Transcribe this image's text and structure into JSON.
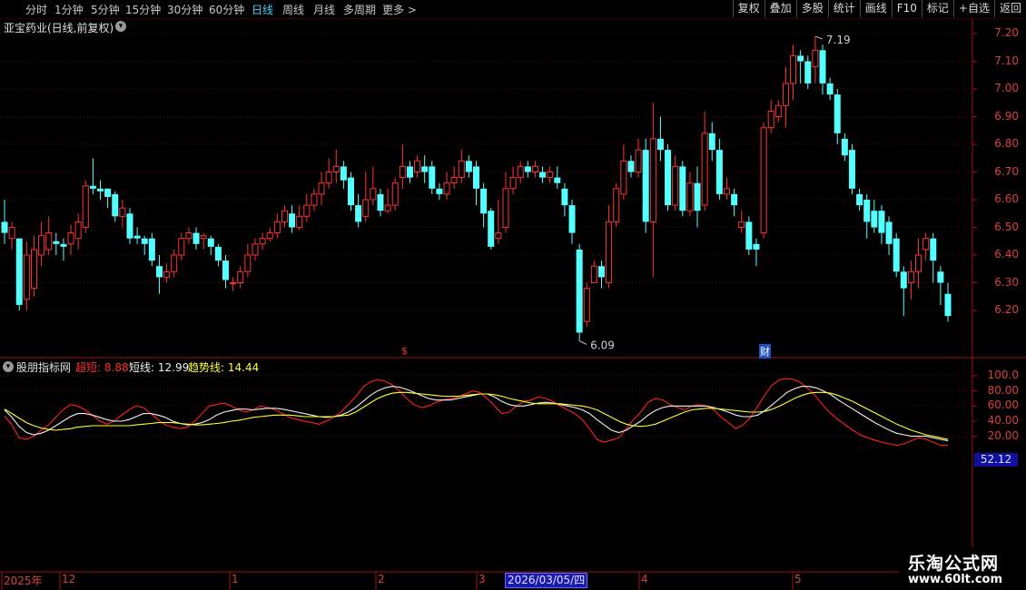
{
  "toolbar": {
    "timeframes": [
      {
        "label": "分时",
        "active": false
      },
      {
        "label": "1分钟",
        "active": false
      },
      {
        "label": "5分钟",
        "active": false
      },
      {
        "label": "15分钟",
        "active": false
      },
      {
        "label": "30分钟",
        "active": false
      },
      {
        "label": "60分钟",
        "active": false
      },
      {
        "label": "日线",
        "active": true
      },
      {
        "label": "周线",
        "active": false
      },
      {
        "label": "月线",
        "active": false
      },
      {
        "label": "多周期",
        "active": false
      },
      {
        "label": "更多 >",
        "active": false
      }
    ],
    "right_buttons": [
      "复权",
      "叠加",
      "多股",
      "统计",
      "画线",
      "F10",
      "标记",
      "+自选",
      "返回"
    ]
  },
  "stock": {
    "title": "亚宝药业(日线,前复权)",
    "dropdown_icon": "chevron-down-icon",
    "high_label": "7.19",
    "low_label": "6.09",
    "event_markers": [
      "$",
      "财"
    ]
  },
  "price_axis": [
    "7.20",
    "7.10",
    "7.00",
    "6.90",
    "6.80",
    "6.70",
    "6.60",
    "6.50",
    "6.40",
    "6.30",
    "6.20"
  ],
  "indicator": {
    "title": "股朋指标网",
    "lines": [
      {
        "name": "超短",
        "value": "8.88",
        "color": "#ff2020"
      },
      {
        "name": "短线",
        "value": "12.99",
        "color": "#f0f0f0"
      },
      {
        "name": "趋势线",
        "value": "14.44",
        "color": "#ffff30"
      }
    ],
    "axis": [
      "100.0",
      "80.00",
      "60.00",
      "40.00",
      "20.00"
    ],
    "cursor_value": "52.12"
  },
  "date_axis": {
    "labels": [
      "2025年",
      "12",
      "1",
      "2",
      "3",
      "4",
      "5"
    ],
    "cursor_date": "2026/03/05/四"
  },
  "watermark": {
    "title": "乐淘公式网",
    "url": "www.60lt.com"
  },
  "colors": {
    "up": "#ff3232",
    "down": "#54ffff",
    "grid": "#5a0000",
    "bg": "#000000"
  },
  "chart_data": {
    "type": "candlestick",
    "ylim": [
      6.09,
      7.19
    ],
    "candles": [
      [
        6.52,
        6.48,
        6.6,
        6.44
      ],
      [
        6.46,
        6.5,
        6.52,
        6.42
      ],
      [
        6.46,
        6.22,
        6.46,
        6.2
      ],
      [
        6.24,
        6.4,
        6.45,
        6.2
      ],
      [
        6.28,
        6.42,
        6.47,
        6.25
      ],
      [
        6.4,
        6.47,
        6.52,
        6.36
      ],
      [
        6.42,
        6.48,
        6.54,
        6.4
      ],
      [
        6.45,
        6.44,
        6.48,
        6.4
      ],
      [
        6.44,
        6.43,
        6.46,
        6.38
      ],
      [
        6.44,
        6.48,
        6.51,
        6.4
      ],
      [
        6.46,
        6.52,
        6.55,
        6.42
      ],
      [
        6.5,
        6.65,
        6.67,
        6.48
      ],
      [
        6.65,
        6.64,
        6.75,
        6.62
      ],
      [
        6.64,
        6.63,
        6.67,
        6.6
      ],
      [
        6.64,
        6.61,
        6.64,
        6.57
      ],
      [
        6.62,
        6.54,
        6.63,
        6.52
      ],
      [
        6.54,
        6.57,
        6.6,
        6.5
      ],
      [
        6.55,
        6.46,
        6.57,
        6.44
      ],
      [
        6.47,
        6.46,
        6.5,
        6.44
      ],
      [
        6.46,
        6.44,
        6.47,
        6.4
      ],
      [
        6.46,
        6.38,
        6.48,
        6.36
      ],
      [
        6.36,
        6.32,
        6.4,
        6.26
      ],
      [
        6.32,
        6.34,
        6.37,
        6.3
      ],
      [
        6.34,
        6.4,
        6.42,
        6.32
      ],
      [
        6.4,
        6.46,
        6.48,
        6.38
      ],
      [
        6.46,
        6.48,
        6.5,
        6.44
      ],
      [
        6.48,
        6.44,
        6.5,
        6.42
      ],
      [
        6.46,
        6.47,
        6.48,
        6.42
      ],
      [
        6.46,
        6.43,
        6.47,
        6.4
      ],
      [
        6.43,
        6.38,
        6.44,
        6.36
      ],
      [
        6.38,
        6.31,
        6.4,
        6.28
      ],
      [
        6.3,
        6.3,
        6.32,
        6.27
      ],
      [
        6.3,
        6.34,
        6.36,
        6.28
      ],
      [
        6.34,
        6.4,
        6.44,
        6.32
      ],
      [
        6.4,
        6.44,
        6.46,
        6.38
      ],
      [
        6.44,
        6.46,
        6.48,
        6.42
      ],
      [
        6.46,
        6.48,
        6.5,
        6.45
      ],
      [
        6.48,
        6.52,
        6.55,
        6.46
      ],
      [
        6.52,
        6.56,
        6.58,
        6.5
      ],
      [
        6.55,
        6.5,
        6.58,
        6.48
      ],
      [
        6.5,
        6.54,
        6.58,
        6.49
      ],
      [
        6.54,
        6.58,
        6.62,
        6.52
      ],
      [
        6.58,
        6.62,
        6.64,
        6.56
      ],
      [
        6.62,
        6.66,
        6.7,
        6.58
      ],
      [
        6.66,
        6.7,
        6.75,
        6.64
      ],
      [
        6.7,
        6.72,
        6.78,
        6.66
      ],
      [
        6.72,
        6.67,
        6.74,
        6.64
      ],
      [
        6.68,
        6.58,
        6.7,
        6.56
      ],
      [
        6.58,
        6.52,
        6.62,
        6.5
      ],
      [
        6.54,
        6.6,
        6.7,
        6.52
      ],
      [
        6.6,
        6.64,
        6.72,
        6.58
      ],
      [
        6.62,
        6.56,
        6.64,
        6.54
      ],
      [
        6.56,
        6.58,
        6.64,
        6.55
      ],
      [
        6.58,
        6.66,
        6.68,
        6.56
      ],
      [
        6.68,
        6.72,
        6.8,
        6.64
      ],
      [
        6.72,
        6.68,
        6.74,
        6.66
      ],
      [
        6.7,
        6.74,
        6.76,
        6.68
      ],
      [
        6.72,
        6.7,
        6.76,
        6.66
      ],
      [
        6.72,
        6.64,
        6.74,
        6.62
      ],
      [
        6.64,
        6.62,
        6.66,
        6.6
      ],
      [
        6.62,
        6.66,
        6.7,
        6.6
      ],
      [
        6.66,
        6.68,
        6.72,
        6.64
      ],
      [
        6.68,
        6.74,
        6.78,
        6.66
      ],
      [
        6.74,
        6.7,
        6.76,
        6.68
      ],
      [
        6.72,
        6.64,
        6.74,
        6.58
      ],
      [
        6.64,
        6.55,
        6.66,
        6.5
      ],
      [
        6.56,
        6.43,
        6.57,
        6.42
      ],
      [
        6.46,
        6.48,
        6.6,
        6.44
      ],
      [
        6.5,
        6.64,
        6.7,
        6.48
      ],
      [
        6.64,
        6.68,
        6.72,
        6.62
      ],
      [
        6.68,
        6.72,
        6.74,
        6.66
      ],
      [
        6.72,
        6.7,
        6.74,
        6.68
      ],
      [
        6.7,
        6.72,
        6.74,
        6.68
      ],
      [
        6.7,
        6.68,
        6.72,
        6.66
      ],
      [
        6.68,
        6.7,
        6.72,
        6.66
      ],
      [
        6.68,
        6.66,
        6.72,
        6.64
      ],
      [
        6.64,
        6.58,
        6.66,
        6.54
      ],
      [
        6.58,
        6.48,
        6.6,
        6.44
      ],
      [
        6.42,
        6.12,
        6.44,
        6.09
      ],
      [
        6.16,
        6.28,
        6.3,
        6.14
      ],
      [
        6.3,
        6.36,
        6.38,
        6.32
      ],
      [
        6.36,
        6.32,
        6.38,
        6.28
      ],
      [
        6.3,
        6.52,
        6.58,
        6.28
      ],
      [
        6.52,
        6.64,
        6.66,
        6.5
      ],
      [
        6.62,
        6.74,
        6.8,
        6.6
      ],
      [
        6.74,
        6.7,
        6.76,
        6.68
      ],
      [
        6.7,
        6.78,
        6.82,
        6.68
      ],
      [
        6.78,
        6.52,
        6.82,
        6.48
      ],
      [
        6.52,
        6.82,
        6.95,
        6.32
      ],
      [
        6.82,
        6.78,
        6.9,
        6.74
      ],
      [
        6.78,
        6.58,
        6.8,
        6.56
      ],
      [
        6.58,
        6.72,
        6.76,
        6.56
      ],
      [
        6.72,
        6.56,
        6.74,
        6.54
      ],
      [
        6.56,
        6.66,
        6.7,
        6.54
      ],
      [
        6.66,
        6.56,
        6.72,
        6.5
      ],
      [
        6.58,
        6.84,
        6.92,
        6.56
      ],
      [
        6.84,
        6.78,
        6.88,
        6.74
      ],
      [
        6.78,
        6.62,
        6.82,
        6.6
      ],
      [
        6.62,
        6.64,
        6.68,
        6.6
      ],
      [
        6.62,
        6.58,
        6.64,
        6.54
      ],
      [
        6.5,
        6.52,
        6.56,
        6.48
      ],
      [
        6.52,
        6.42,
        6.54,
        6.4
      ],
      [
        6.44,
        6.42,
        6.46,
        6.36
      ],
      [
        6.48,
        6.86,
        6.88,
        6.46
      ],
      [
        6.86,
        6.92,
        6.96,
        6.84
      ],
      [
        6.9,
        6.94,
        6.96,
        6.88
      ],
      [
        6.94,
        7.02,
        7.08,
        6.86
      ],
      [
        7.02,
        7.12,
        7.16,
        6.96
      ],
      [
        7.12,
        7.1,
        7.14,
        7.02
      ],
      [
        7.1,
        7.02,
        7.12,
        7.0
      ],
      [
        7.08,
        7.14,
        7.19,
        7.02
      ],
      [
        7.14,
        7.02,
        7.16,
        6.98
      ],
      [
        7.02,
        6.98,
        7.04,
        6.96
      ],
      [
        6.98,
        6.84,
        7.0,
        6.8
      ],
      [
        6.82,
        6.76,
        6.84,
        6.74
      ],
      [
        6.78,
        6.64,
        6.8,
        6.62
      ],
      [
        6.62,
        6.58,
        6.64,
        6.56
      ],
      [
        6.6,
        6.52,
        6.62,
        6.46
      ],
      [
        6.56,
        6.5,
        6.6,
        6.48
      ],
      [
        6.56,
        6.48,
        6.58,
        6.44
      ],
      [
        6.52,
        6.44,
        6.54,
        6.4
      ],
      [
        6.46,
        6.34,
        6.48,
        6.32
      ],
      [
        6.34,
        6.28,
        6.36,
        6.18
      ],
      [
        6.3,
        6.34,
        6.38,
        6.24
      ],
      [
        6.34,
        6.4,
        6.46,
        6.28
      ],
      [
        6.42,
        6.46,
        6.48,
        6.38
      ],
      [
        6.46,
        6.38,
        6.48,
        6.3
      ],
      [
        6.34,
        6.3,
        6.36,
        6.22
      ],
      [
        6.26,
        6.18,
        6.3,
        6.16
      ]
    ],
    "indicator_series": [
      {
        "name": "超短",
        "color": "#ff2020",
        "values": [
          47,
          35,
          18,
          16,
          20,
          28,
          35,
          45,
          55,
          62,
          60,
          55,
          48,
          40,
          36,
          40,
          48,
          55,
          60,
          58,
          50,
          42,
          35,
          32,
          30,
          32,
          40,
          50,
          60,
          62,
          64,
          60,
          55,
          52,
          55,
          60,
          58,
          55,
          50,
          45,
          42,
          40,
          38,
          36,
          40,
          45,
          52,
          62,
          72,
          85,
          92,
          95,
          93,
          88,
          80,
          70,
          62,
          58,
          60,
          65,
          68,
          70,
          72,
          76,
          80,
          78,
          70,
          60,
          50,
          52,
          60,
          66,
          68,
          72,
          70,
          66,
          60,
          55,
          50,
          42,
          30,
          16,
          12,
          15,
          18,
          30,
          42,
          52,
          65,
          70,
          68,
          62,
          58,
          55,
          60,
          62,
          60,
          55,
          45,
          38,
          30,
          35,
          45,
          60,
          75,
          88,
          95,
          96,
          95,
          90,
          82,
          72,
          60,
          50,
          42,
          35,
          28,
          22,
          18,
          15,
          12,
          10,
          8,
          10,
          14,
          18,
          16,
          12,
          8,
          8
        ]
      },
      {
        "name": "短线",
        "color": "#f0f0f0",
        "values": [
          55,
          45,
          33,
          25,
          22,
          24,
          28,
          34,
          40,
          46,
          50,
          50,
          48,
          45,
          42,
          40,
          40,
          42,
          46,
          50,
          50,
          48,
          45,
          40,
          37,
          35,
          36,
          38,
          42,
          48,
          52,
          54,
          56,
          56,
          55,
          56,
          57,
          57,
          56,
          54,
          52,
          50,
          48,
          46,
          45,
          46,
          48,
          52,
          58,
          66,
          74,
          80,
          84,
          86,
          85,
          82,
          78,
          74,
          70,
          68,
          68,
          68,
          70,
          72,
          74,
          76,
          76,
          72,
          66,
          62,
          60,
          60,
          62,
          64,
          65,
          64,
          62,
          60,
          58,
          55,
          50,
          42,
          35,
          28,
          25,
          28,
          34,
          40,
          48,
          54,
          58,
          60,
          60,
          60,
          60,
          60,
          60,
          58,
          55,
          52,
          48,
          46,
          46,
          48,
          54,
          62,
          70,
          78,
          83,
          86,
          86,
          84,
          80,
          75,
          68,
          62,
          56,
          50,
          44,
          38,
          33,
          28,
          24,
          22,
          20,
          20,
          20,
          18,
          16,
          14
        ]
      },
      {
        "name": "趋势线",
        "color": "#ffff30",
        "values": [
          56,
          50,
          44,
          38,
          34,
          31,
          29,
          28,
          29,
          30,
          32,
          33,
          34,
          34,
          34,
          34,
          34,
          34,
          35,
          36,
          37,
          38,
          38,
          38,
          37,
          36,
          35,
          35,
          36,
          37,
          38,
          40,
          41,
          43,
          45,
          46,
          47,
          48,
          48,
          48,
          47,
          46,
          46,
          46,
          46,
          46,
          47,
          48,
          52,
          58,
          64,
          70,
          74,
          77,
          78,
          78,
          77,
          76,
          75,
          74,
          73,
          73,
          73,
          74,
          75,
          76,
          76,
          75,
          73,
          70,
          68,
          66,
          64,
          63,
          63,
          63,
          63,
          62,
          61,
          60,
          58,
          55,
          50,
          45,
          40,
          36,
          34,
          33,
          34,
          36,
          40,
          44,
          48,
          52,
          55,
          56,
          57,
          57,
          56,
          55,
          54,
          53,
          52,
          52,
          53,
          56,
          60,
          65,
          70,
          74,
          77,
          78,
          78,
          77,
          74,
          70,
          66,
          61,
          56,
          51,
          46,
          41,
          36,
          32,
          28,
          25,
          22,
          20,
          18,
          16
        ]
      }
    ]
  }
}
